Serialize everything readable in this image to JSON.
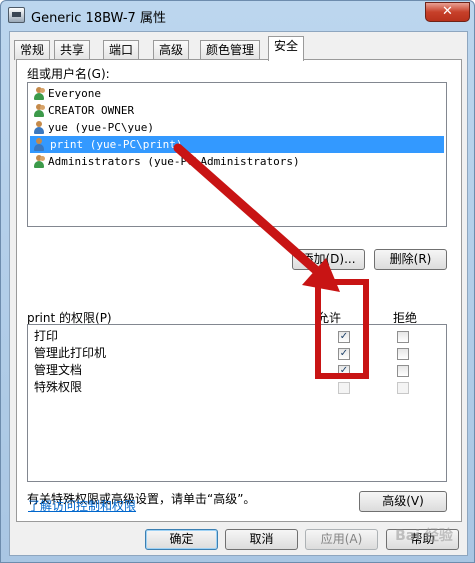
{
  "window": {
    "title": "Generic 18BW-7 属性",
    "close_symbol": "✕"
  },
  "tabs": [
    {
      "label": "常规",
      "active": false
    },
    {
      "label": "共享",
      "active": false
    },
    {
      "label": "端口",
      "active": false
    },
    {
      "label": "高级",
      "active": false
    },
    {
      "label": "颜色管理",
      "active": false
    },
    {
      "label": "安全",
      "active": true
    }
  ],
  "security": {
    "group_label": "组或用户名(G):",
    "users": [
      {
        "name": "Everyone",
        "icon": "group-icon",
        "selected": false
      },
      {
        "name": "CREATOR OWNER",
        "icon": "group-icon",
        "selected": false
      },
      {
        "name": "yue (yue-PC\\yue)",
        "icon": "user-icon",
        "selected": false
      },
      {
        "name": "print (yue-PC\\print)",
        "icon": "user-icon",
        "selected": true
      },
      {
        "name": "Administrators (yue-PC\\Administrators)",
        "icon": "group-icon",
        "selected": false
      }
    ],
    "add_button": "添加(D)...",
    "remove_button": "删除(R)",
    "perm_label": "print 的权限(P)",
    "allow_header": "允许",
    "deny_header": "拒绝",
    "permissions": [
      {
        "name": "打印",
        "allow": true,
        "deny": false,
        "enabled": true
      },
      {
        "name": "管理此打印机",
        "allow": true,
        "deny": false,
        "enabled": true
      },
      {
        "name": "管理文档",
        "allow": true,
        "deny": false,
        "enabled": true
      },
      {
        "name": "特殊权限",
        "allow": false,
        "deny": false,
        "enabled": false
      }
    ],
    "advanced_hint": "有关特殊权限或高级设置，请单击“高级”。",
    "advanced_button": "高级(V)",
    "learn_link": "了解访问控制和权限"
  },
  "footer": {
    "ok": "确定",
    "cancel": "取消",
    "apply": "应用(A)",
    "help": "帮助"
  },
  "annotation": {
    "arrow_color": "#c81414",
    "box_color": "#c81414"
  },
  "watermark_text": "Bai 经验"
}
